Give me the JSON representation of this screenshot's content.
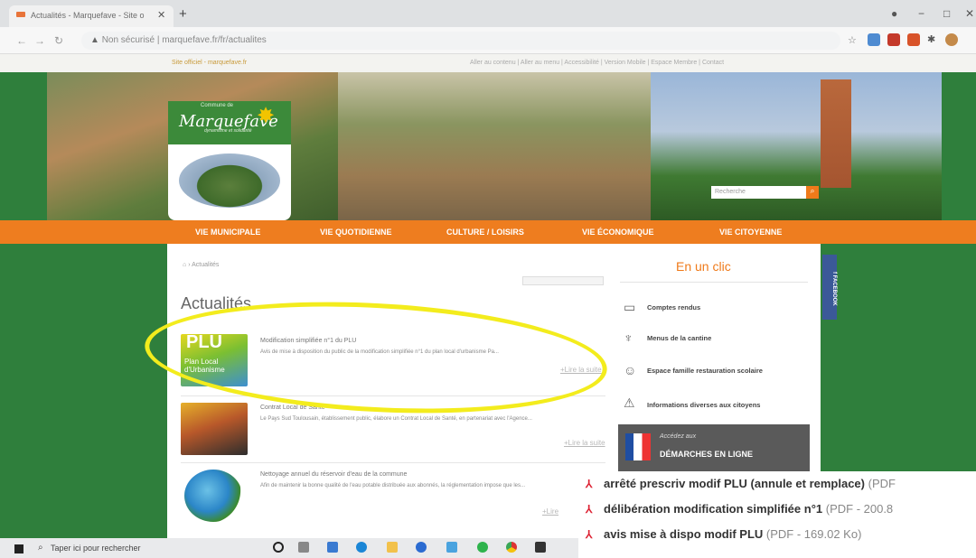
{
  "browser": {
    "tab_title": "Actualités - Marquefave - Site o",
    "url_prefix": "Non sécurisé",
    "url": "marquefave.fr/fr/actualites"
  },
  "site": {
    "official": "Site officiel - marquefave.fr",
    "top_links": "Aller au contenu | Aller au menu | Accessibilité | Version Mobile | Espace Membre | Contact",
    "logo_small": "Commune de",
    "logo_name": "Marquefave",
    "logo_sub": "dynamisme et solidarité",
    "search_placeholder": "Recherche",
    "menu": [
      "VIE MUNICIPALE",
      "VIE QUOTIDIENNE",
      "CULTURE / LOISIRS",
      "VIE ÉCONOMIQUE",
      "VIE CITOYENNE"
    ],
    "breadcrumb": "› Actualités",
    "page_title": "Actualités",
    "articles": [
      {
        "title": "Modification simplifiée n°1 du PLU",
        "text": "Avis de mise à disposition du public de la modification simplifiée n°1 du plan local d'urbanisme Pa...",
        "more": "+Lire la suite",
        "thumb_label": "PLU",
        "thumb_sub": "Plan Local d'Urbanisme"
      },
      {
        "title": "Contrat Local de Santé",
        "text": "Le Pays Sud Toulousain, établissement public, élabore un Contrat Local de Santé, en partenariat avec l'Agence...",
        "more": "+Lire la suite"
      },
      {
        "title": "Nettoyage annuel du réservoir d'eau de la commune",
        "text": "Afin de maintenir la bonne qualité de l'eau potable distribuée aux abonnés, la réglementation impose que les...",
        "more": "+Lire"
      }
    ],
    "sidebar_title": "En un clic",
    "sidebar_items": [
      "Comptes rendus",
      "Menus de la cantine",
      "Espace famille restauration scolaire",
      "Informations diverses aux citoyens"
    ],
    "demarches_small": "Accédez aux",
    "demarches_big": "DÉMARCHES EN LIGNE",
    "facebook": "f FACEBOOK"
  },
  "pdf_list": [
    {
      "name": "arrêté prescriv modif PLU (annule et remplace)",
      "meta": "(PDF"
    },
    {
      "name": "délibération modification simplifiée n°1",
      "meta": "(PDF - 200.8"
    },
    {
      "name": "avis mise à dispo modif PLU",
      "meta": "(PDF - 169.02 Ko)"
    }
  ],
  "taskbar": {
    "search_text": "Taper ici pour rechercher"
  }
}
